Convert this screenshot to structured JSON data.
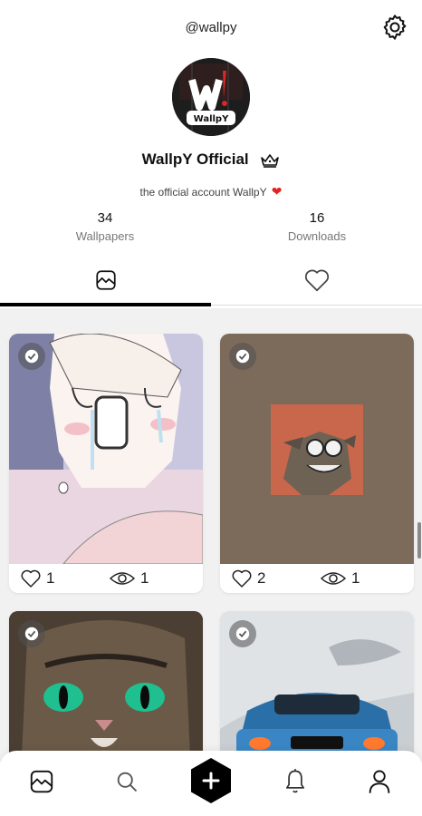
{
  "header": {
    "handle": "@wallpy",
    "settings_icon": "gear-icon"
  },
  "profile": {
    "name": "WallpY Official",
    "verified_icon": "crown-icon",
    "bio": "the official account WallpY",
    "bio_emoji": "❤",
    "avatar_text": "WallpY"
  },
  "stats": [
    {
      "value": "34",
      "label": "Wallpapers"
    },
    {
      "value": "16",
      "label": "Downloads"
    }
  ],
  "tabs": [
    {
      "icon": "image-icon",
      "active": true
    },
    {
      "icon": "heart-outline-icon",
      "active": false
    }
  ],
  "cards": [
    {
      "subject": "crying anime child",
      "likes": "1",
      "views": "1"
    },
    {
      "subject": "skull cat on orange",
      "likes": "2",
      "views": "1"
    },
    {
      "subject": "green-eyed cat",
      "likes": "",
      "views": ""
    },
    {
      "subject": "blue sports car",
      "likes": "",
      "views": ""
    }
  ],
  "bottom_nav": [
    {
      "icon": "image-icon"
    },
    {
      "icon": "search-icon"
    },
    {
      "icon": "add-icon"
    },
    {
      "icon": "bell-icon"
    },
    {
      "icon": "profile-icon"
    }
  ],
  "colors": {
    "accent": "#000000",
    "heart": "#e02424",
    "grid_bg": "#f1f1f1"
  }
}
